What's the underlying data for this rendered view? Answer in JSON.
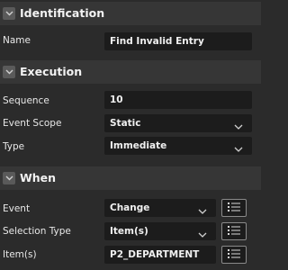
{
  "sections": {
    "identification": {
      "title": "Identification",
      "name_label": "Name",
      "name_value": "Find Invalid Entry"
    },
    "execution": {
      "title": "Execution",
      "sequence_label": "Sequence",
      "sequence_value": "10",
      "event_scope_label": "Event Scope",
      "event_scope_value": "Static",
      "type_label": "Type",
      "type_value": "Immediate"
    },
    "when": {
      "title": "When",
      "event_label": "Event",
      "event_value": "Change",
      "selection_type_label": "Selection Type",
      "selection_type_value": "Item(s)",
      "items_label": "Item(s)",
      "items_value": "P2_DEPARTMENT"
    }
  },
  "icons": {
    "collapse": "chevron-down-icon",
    "dropdown": "chevron-down-icon",
    "list": "list-icon"
  },
  "colors": {
    "background": "#2b2b2b",
    "header": "#363636",
    "field": "#1c1c1c",
    "text": "#e6e6e6"
  }
}
